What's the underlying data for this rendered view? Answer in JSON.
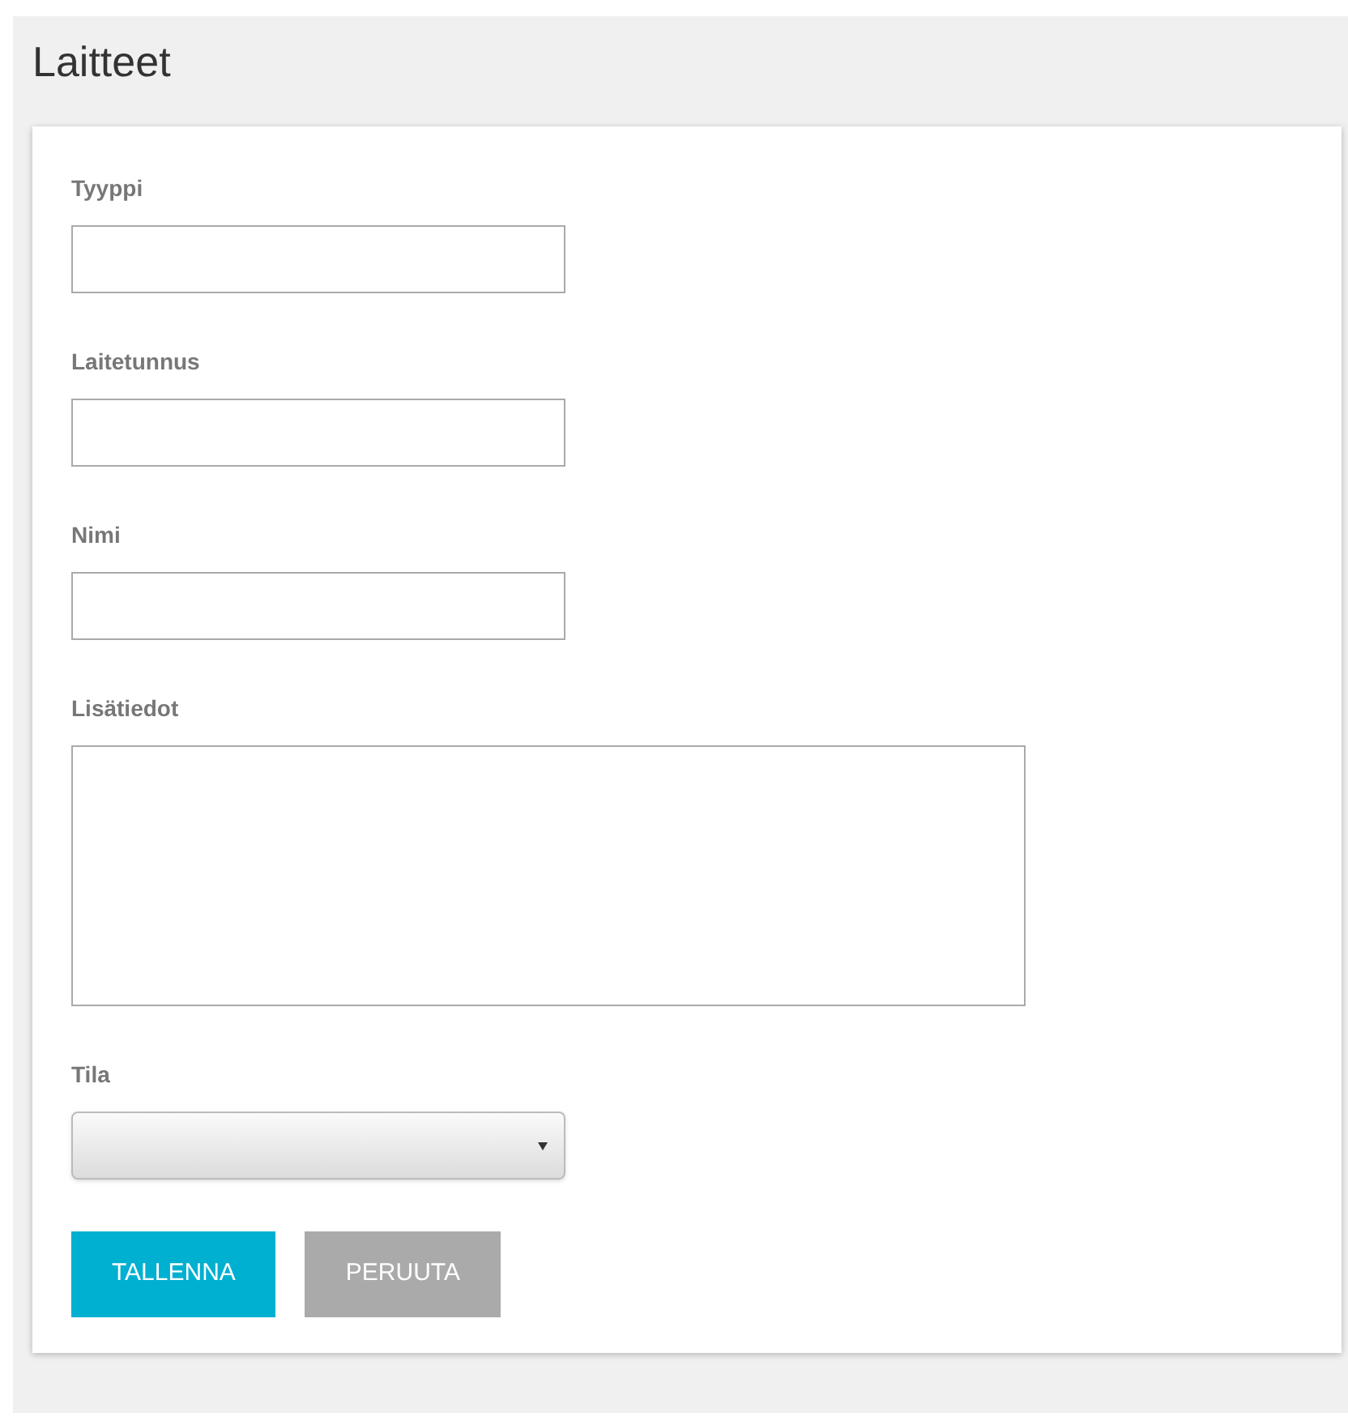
{
  "page": {
    "title": "Laitteet"
  },
  "fields": [
    {
      "label": "Tyyppi",
      "kind": "text"
    },
    {
      "label": "Laitetunnus",
      "kind": "text"
    },
    {
      "label": "Nimi",
      "kind": "text"
    },
    {
      "label": "Lisätiedot",
      "kind": "textarea"
    },
    {
      "label": "Tila",
      "kind": "select"
    }
  ],
  "buttons": [
    {
      "label": "TALLENNA",
      "kind": "primary"
    },
    {
      "label": "PERUUTA",
      "kind": "secondary"
    }
  ]
}
